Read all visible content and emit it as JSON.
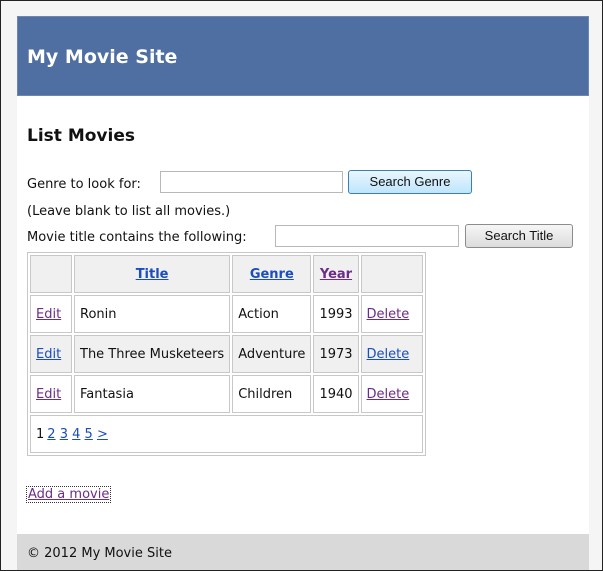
{
  "header": {
    "site_title": "My Movie Site"
  },
  "main": {
    "page_title": "List Movies",
    "genre_search": {
      "label": "Genre to look for:",
      "value": "",
      "button_label": "Search Genre",
      "hint": "(Leave blank to list all movies.)"
    },
    "title_search": {
      "label": "Movie title contains the following:",
      "value": "",
      "button_label": "Search Title"
    },
    "table": {
      "headers": {
        "title": "Title",
        "genre": "Genre",
        "year": "Year"
      },
      "rows": [
        {
          "edit": "Edit",
          "title": "Ronin",
          "genre": "Action",
          "year": "1993",
          "delete": "Delete"
        },
        {
          "edit": "Edit",
          "title": "The Three Musketeers",
          "genre": "Adventure",
          "year": "1973",
          "delete": "Delete"
        },
        {
          "edit": "Edit",
          "title": "Fantasia",
          "genre": "Children",
          "year": "1940",
          "delete": "Delete"
        }
      ],
      "pager": {
        "current": "1",
        "pages": [
          "2",
          "3",
          "4",
          "5"
        ],
        "next": ">"
      }
    },
    "add_link": "Add a movie"
  },
  "footer": {
    "text": "© 2012 My Movie Site"
  },
  "colors": {
    "header_bg": "#4f6fa3",
    "link": "#1a4dbf",
    "visited_link": "#6b2c8a",
    "footer_bg": "#d9d9d9"
  }
}
